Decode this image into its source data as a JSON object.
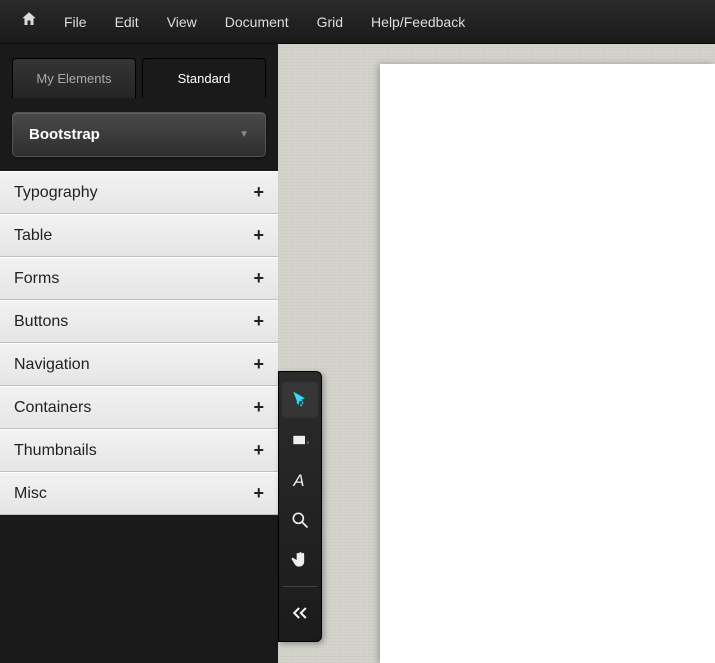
{
  "menubar": {
    "items": [
      "File",
      "Edit",
      "View",
      "Document",
      "Grid",
      "Help/Feedback"
    ]
  },
  "sidebar": {
    "tabs": [
      {
        "label": "My Elements",
        "active": false
      },
      {
        "label": "Standard",
        "active": true
      }
    ],
    "framework": "Bootstrap",
    "categories": [
      "Typography",
      "Table",
      "Forms",
      "Buttons",
      "Navigation",
      "Containers",
      "Thumbnails",
      "Misc"
    ]
  },
  "tools": {
    "items": [
      {
        "name": "select-move-tool",
        "active": true
      },
      {
        "name": "rectangle-tool",
        "active": false
      },
      {
        "name": "text-tool",
        "active": false
      },
      {
        "name": "zoom-tool",
        "active": false
      },
      {
        "name": "pan-hand-tool",
        "active": false
      }
    ],
    "collapse": "collapse-tools"
  }
}
